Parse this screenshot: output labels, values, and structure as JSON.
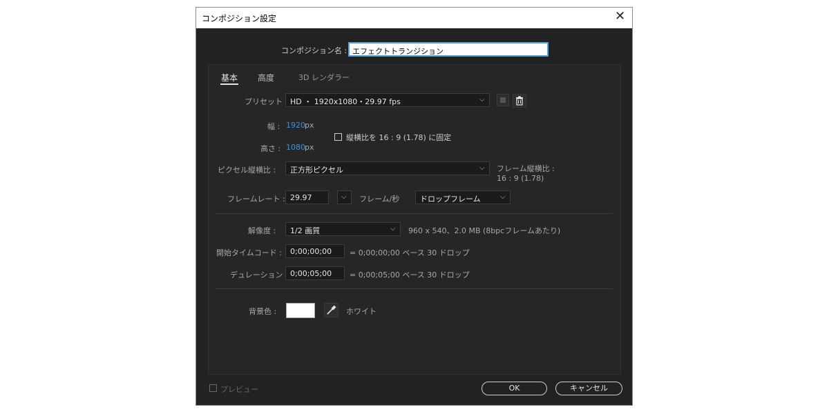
{
  "dialog": {
    "title": "コンポジション設定",
    "close_symbol": "✕"
  },
  "comp_name": {
    "label": "コンポジション名 :",
    "value": "エフェクトトランジション"
  },
  "tabs": [
    {
      "label": "基本",
      "active": true
    },
    {
      "label": "高度",
      "active": false
    },
    {
      "label": "3D レンダラー",
      "active": false
    }
  ],
  "preset": {
    "label": "プリセット :",
    "value": "HD ・ 1920x1080・29.97 fps"
  },
  "size": {
    "width_label": "幅 :",
    "width_value": "1920",
    "width_unit": "px",
    "height_label": "高さ :",
    "height_value": "1080",
    "height_unit": "px",
    "lock_label": "縦横比を 16 : 9 (1.78) に固定",
    "lock_checked": false
  },
  "pixel_aspect": {
    "label": "ピクセル縦横比 :",
    "value": "正方形ピクセル",
    "frame_aspect_label": "フレーム縦横比 :",
    "frame_aspect_value": "16 : 9 (1.78)"
  },
  "frame_rate": {
    "label": "フレームレート :",
    "value": "29.97",
    "unit": "フレーム/秒",
    "drop_value": "ドロップフレーム"
  },
  "resolution": {
    "label": "解像度 :",
    "value": "1/2 画質",
    "info": "960 x 540、2.0 MB (8bpcフレームあたり)"
  },
  "start_timecode": {
    "label": "開始タイムコード :",
    "value": "0;00;00;00",
    "info": "= 0;00;00;00  ベース 30   ドロップ"
  },
  "duration": {
    "label": "デュレーション :",
    "value": "0;00;05;00",
    "info": "= 0;00;05;00  ベース 30   ドロップ"
  },
  "background": {
    "label": "背景色 :",
    "color": "#ffffff",
    "name": "ホワイト"
  },
  "footer": {
    "preview_label": "プレビュー",
    "ok_label": "OK",
    "cancel_label": "キャンセル"
  },
  "colors": {
    "dialog_bg": "#222222",
    "accent_blue": "#3f93e0"
  }
}
